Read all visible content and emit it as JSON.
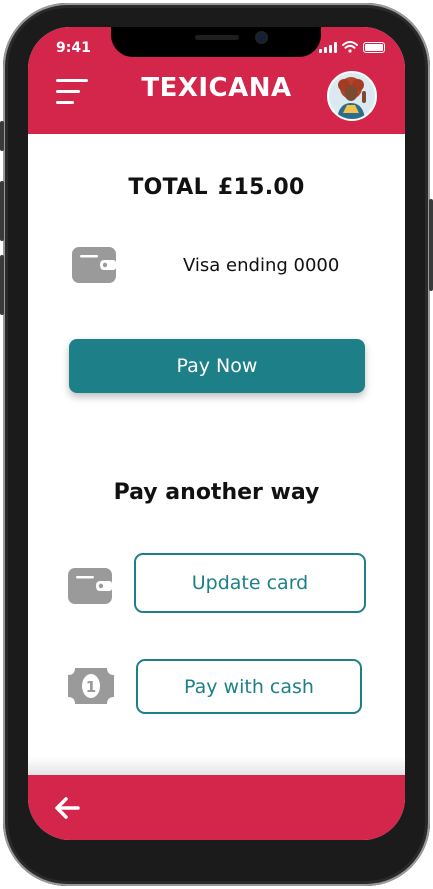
{
  "status_bar": {
    "time": "9:41"
  },
  "header": {
    "brand": "TEXICANA",
    "menu_icon": "hamburger-menu-icon",
    "avatar": "user-avatar"
  },
  "summary": {
    "total_label": "TOTAL",
    "total_amount": "£15.00"
  },
  "payment_method": {
    "icon": "wallet-icon",
    "label": "Visa ending 0000"
  },
  "primary_action": {
    "label": "Pay Now"
  },
  "alternatives": {
    "heading": "Pay another way",
    "update_card": {
      "icon": "wallet-icon",
      "label": "Update card"
    },
    "pay_cash": {
      "icon": "cash-icon",
      "label": "Pay with cash"
    }
  },
  "footer": {
    "back_icon": "back-arrow-icon"
  },
  "colors": {
    "brand": "#d4264b",
    "accent": "#1d8089",
    "icon_gray": "#9a9a9a"
  }
}
